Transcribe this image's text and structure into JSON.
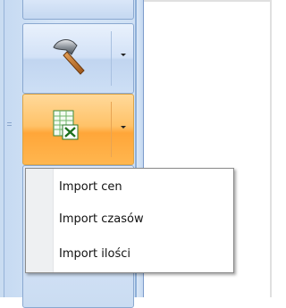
{
  "ribbon": {
    "tools_button": {
      "icon": "hammer-icon"
    },
    "import_button": {
      "icon": "excel-import-icon",
      "state": "pressed",
      "accent": "#ffb347"
    }
  },
  "import_menu": {
    "items": [
      {
        "label": "Import cen"
      },
      {
        "label": "Import czasów"
      },
      {
        "label": "Import ilości"
      }
    ]
  }
}
